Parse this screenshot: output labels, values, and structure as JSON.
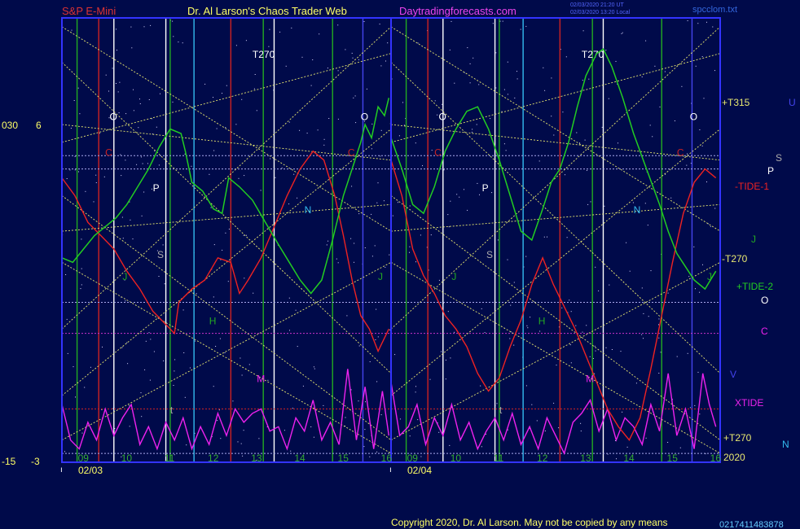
{
  "header": {
    "left_title": "S&P E-Mini",
    "center_title": "Dr. Al Larson's Chaos Trader Web",
    "site": "Daytradingforecasts.com",
    "stamp_line1": "02/03/2020 21:20 UT",
    "stamp_line2": "02/03/2020 13:20 Local",
    "file": "spcclom.txt"
  },
  "footer": {
    "copyright": "Copyright 2020, Dr. Al Larson. May not be copied by any means",
    "corner": "0217411483878"
  },
  "colors": {
    "background": "#000a4a",
    "frame": "#3333ff",
    "price": "#22cc22",
    "tide": "#ee2222",
    "xtide": "#ee22ee",
    "trend": "#e8e870",
    "marker_red": "#cc2222",
    "marker_green": "#22aa22",
    "marker_white": "#ffffff",
    "marker_cyan": "#33bbee",
    "marker_blue": "#4444ee"
  },
  "chart_data": {
    "type": "line",
    "y_scale_left": {
      "top_labels": [
        "030",
        "6"
      ],
      "bottom_labels": [
        "-15",
        "-3"
      ]
    },
    "panels": [
      {
        "date": "02/03",
        "hours": [
          "09",
          "10",
          "11",
          "12",
          "13",
          "14",
          "15",
          "16"
        ],
        "top_label": "T270",
        "glyphs": [
          {
            "text": "O",
            "color": "#ffffff",
            "t": 9.6,
            "v": 0.77
          },
          {
            "text": "C",
            "color": "#cc2222",
            "t": 9.5,
            "v": 0.69
          },
          {
            "text": "P",
            "color": "#ffffff",
            "t": 10.6,
            "v": 0.61
          },
          {
            "text": "S",
            "color": "#aaaaaa",
            "t": 10.7,
            "v": 0.46
          },
          {
            "text": "J",
            "color": "#22aa22",
            "t": 9.9,
            "v": 0.41
          },
          {
            "text": "H",
            "color": "#22aa22",
            "t": 11.9,
            "v": 0.31
          },
          {
            "text": "N",
            "color": "#33bbee",
            "t": 14.1,
            "v": 0.56
          },
          {
            "text": "M",
            "color": "#ee22ee",
            "t": 13.0,
            "v": 0.18
          },
          {
            "text": "t",
            "color": "#aaaaaa",
            "t": 11.0,
            "v": 0.11
          },
          {
            "text": "O",
            "color": "#ffffff",
            "t": 15.4,
            "v": 0.77
          },
          {
            "text": "C",
            "color": "#cc2222",
            "t": 15.1,
            "v": 0.69
          },
          {
            "text": "J",
            "color": "#22aa22",
            "t": 15.8,
            "v": 0.41
          }
        ],
        "price": [
          [
            8.5,
            0.46
          ],
          [
            8.75,
            0.45
          ],
          [
            9.0,
            0.48
          ],
          [
            9.25,
            0.51
          ],
          [
            9.5,
            0.53
          ],
          [
            9.75,
            0.55
          ],
          [
            10.0,
            0.58
          ],
          [
            10.25,
            0.62
          ],
          [
            10.5,
            0.66
          ],
          [
            10.75,
            0.71
          ],
          [
            11.0,
            0.75
          ],
          [
            11.25,
            0.74
          ],
          [
            11.35,
            0.7
          ],
          [
            11.5,
            0.63
          ],
          [
            11.75,
            0.61
          ],
          [
            12.0,
            0.57
          ],
          [
            12.2,
            0.56
          ],
          [
            12.35,
            0.64
          ],
          [
            12.6,
            0.62
          ],
          [
            12.9,
            0.59
          ],
          [
            13.2,
            0.54
          ],
          [
            13.5,
            0.49
          ],
          [
            13.75,
            0.45
          ],
          [
            14.0,
            0.41
          ],
          [
            14.25,
            0.38
          ],
          [
            14.5,
            0.41
          ],
          [
            14.75,
            0.5
          ],
          [
            15.0,
            0.6
          ],
          [
            15.2,
            0.66
          ],
          [
            15.4,
            0.72
          ],
          [
            15.5,
            0.76
          ],
          [
            15.65,
            0.73
          ],
          [
            15.8,
            0.8
          ],
          [
            15.95,
            0.78
          ],
          [
            16.05,
            0.82
          ]
        ],
        "tide": [
          [
            8.5,
            0.64
          ],
          [
            8.8,
            0.6
          ],
          [
            9.1,
            0.54
          ],
          [
            9.4,
            0.51
          ],
          [
            9.7,
            0.48
          ],
          [
            10.0,
            0.43
          ],
          [
            10.3,
            0.39
          ],
          [
            10.6,
            0.34
          ],
          [
            10.9,
            0.31
          ],
          [
            11.1,
            0.29
          ],
          [
            11.2,
            0.36
          ],
          [
            11.5,
            0.39
          ],
          [
            11.8,
            0.41
          ],
          [
            12.1,
            0.46
          ],
          [
            12.4,
            0.45
          ],
          [
            12.6,
            0.38
          ],
          [
            12.8,
            0.41
          ],
          [
            13.1,
            0.46
          ],
          [
            13.4,
            0.53
          ],
          [
            13.7,
            0.6
          ],
          [
            14.0,
            0.66
          ],
          [
            14.3,
            0.7
          ],
          [
            14.55,
            0.68
          ],
          [
            14.8,
            0.6
          ],
          [
            15.0,
            0.51
          ],
          [
            15.2,
            0.41
          ],
          [
            15.4,
            0.33
          ],
          [
            15.6,
            0.3
          ],
          [
            15.8,
            0.25
          ],
          [
            16.05,
            0.3
          ]
        ],
        "xtide": [
          [
            8.5,
            0.13
          ],
          [
            8.7,
            0.05
          ],
          [
            8.9,
            0.03
          ],
          [
            9.1,
            0.09
          ],
          [
            9.3,
            0.05
          ],
          [
            9.5,
            0.12
          ],
          [
            9.7,
            0.06
          ],
          [
            9.9,
            0.1
          ],
          [
            10.1,
            0.13
          ],
          [
            10.3,
            0.04
          ],
          [
            10.5,
            0.08
          ],
          [
            10.7,
            0.03
          ],
          [
            10.9,
            0.09
          ],
          [
            11.1,
            0.05
          ],
          [
            11.3,
            0.1
          ],
          [
            11.5,
            0.03
          ],
          [
            11.7,
            0.08
          ],
          [
            11.9,
            0.04
          ],
          [
            12.1,
            0.11
          ],
          [
            12.3,
            0.06
          ],
          [
            12.5,
            0.12
          ],
          [
            12.7,
            0.09
          ],
          [
            12.9,
            0.11
          ],
          [
            13.1,
            0.12
          ],
          [
            13.3,
            0.07
          ],
          [
            13.5,
            0.08
          ],
          [
            13.7,
            0.03
          ],
          [
            13.9,
            0.1
          ],
          [
            14.1,
            0.07
          ],
          [
            14.3,
            0.14
          ],
          [
            14.5,
            0.05
          ],
          [
            14.7,
            0.09
          ],
          [
            14.9,
            0.04
          ],
          [
            15.1,
            0.21
          ],
          [
            15.3,
            0.05
          ],
          [
            15.5,
            0.17
          ],
          [
            15.7,
            0.03
          ],
          [
            15.9,
            0.16
          ],
          [
            16.05,
            0.06
          ]
        ]
      },
      {
        "date": "02/04",
        "hours": [
          "09",
          "10",
          "11",
          "12",
          "13",
          "14",
          "15",
          "16"
        ],
        "top_label": "T270",
        "glyphs": [
          {
            "text": "O",
            "color": "#ffffff",
            "t": 9.6,
            "v": 0.77
          },
          {
            "text": "C",
            "color": "#cc2222",
            "t": 9.5,
            "v": 0.69
          },
          {
            "text": "P",
            "color": "#ffffff",
            "t": 10.6,
            "v": 0.61
          },
          {
            "text": "S",
            "color": "#aaaaaa",
            "t": 10.7,
            "v": 0.46
          },
          {
            "text": "J",
            "color": "#22aa22",
            "t": 9.9,
            "v": 0.41
          },
          {
            "text": "H",
            "color": "#22aa22",
            "t": 11.9,
            "v": 0.31
          },
          {
            "text": "N",
            "color": "#33bbee",
            "t": 14.1,
            "v": 0.56
          },
          {
            "text": "M",
            "color": "#ee22ee",
            "t": 13.0,
            "v": 0.18
          },
          {
            "text": "t",
            "color": "#aaaaaa",
            "t": 11.0,
            "v": 0.11
          },
          {
            "text": "O",
            "color": "#ffffff",
            "t": 15.4,
            "v": 0.77
          },
          {
            "text": "C",
            "color": "#cc2222",
            "t": 15.1,
            "v": 0.69
          },
          {
            "text": "J",
            "color": "#22aa22",
            "t": 15.8,
            "v": 0.41
          }
        ],
        "price": [
          [
            8.5,
            0.73
          ],
          [
            8.75,
            0.66
          ],
          [
            9.0,
            0.58
          ],
          [
            9.25,
            0.56
          ],
          [
            9.5,
            0.62
          ],
          [
            9.75,
            0.7
          ],
          [
            10.0,
            0.75
          ],
          [
            10.25,
            0.79
          ],
          [
            10.5,
            0.8
          ],
          [
            10.75,
            0.75
          ],
          [
            11.0,
            0.68
          ],
          [
            11.25,
            0.6
          ],
          [
            11.5,
            0.52
          ],
          [
            11.75,
            0.5
          ],
          [
            12.0,
            0.57
          ],
          [
            12.2,
            0.63
          ],
          [
            12.4,
            0.66
          ],
          [
            12.6,
            0.72
          ],
          [
            12.8,
            0.8
          ],
          [
            13.0,
            0.87
          ],
          [
            13.25,
            0.92
          ],
          [
            13.4,
            0.93
          ],
          [
            13.6,
            0.89
          ],
          [
            13.85,
            0.82
          ],
          [
            14.1,
            0.74
          ],
          [
            14.4,
            0.66
          ],
          [
            14.7,
            0.58
          ],
          [
            14.9,
            0.52
          ],
          [
            15.1,
            0.47
          ],
          [
            15.3,
            0.44
          ],
          [
            15.5,
            0.41
          ],
          [
            15.75,
            0.39
          ],
          [
            16.0,
            0.43
          ]
        ],
        "tide": [
          [
            8.5,
            0.68
          ],
          [
            8.75,
            0.6
          ],
          [
            9.0,
            0.48
          ],
          [
            9.25,
            0.42
          ],
          [
            9.5,
            0.38
          ],
          [
            9.75,
            0.33
          ],
          [
            10.0,
            0.3
          ],
          [
            10.25,
            0.26
          ],
          [
            10.5,
            0.2
          ],
          [
            10.75,
            0.16
          ],
          [
            11.0,
            0.19
          ],
          [
            11.25,
            0.26
          ],
          [
            11.5,
            0.32
          ],
          [
            11.75,
            0.4
          ],
          [
            12.0,
            0.46
          ],
          [
            12.25,
            0.4
          ],
          [
            12.5,
            0.35
          ],
          [
            12.75,
            0.3
          ],
          [
            13.0,
            0.24
          ],
          [
            13.25,
            0.18
          ],
          [
            13.5,
            0.12
          ],
          [
            13.75,
            0.08
          ],
          [
            14.0,
            0.05
          ],
          [
            14.25,
            0.1
          ],
          [
            14.5,
            0.21
          ],
          [
            14.75,
            0.33
          ],
          [
            15.0,
            0.45
          ],
          [
            15.25,
            0.56
          ],
          [
            15.5,
            0.63
          ],
          [
            15.75,
            0.66
          ],
          [
            16.0,
            0.64
          ]
        ],
        "xtide": [
          [
            8.5,
            0.18
          ],
          [
            8.7,
            0.06
          ],
          [
            8.9,
            0.08
          ],
          [
            9.1,
            0.13
          ],
          [
            9.3,
            0.04
          ],
          [
            9.5,
            0.1
          ],
          [
            9.7,
            0.06
          ],
          [
            9.9,
            0.13
          ],
          [
            10.1,
            0.05
          ],
          [
            10.3,
            0.09
          ],
          [
            10.5,
            0.03
          ],
          [
            10.7,
            0.07
          ],
          [
            10.9,
            0.1
          ],
          [
            11.1,
            0.05
          ],
          [
            11.3,
            0.11
          ],
          [
            11.5,
            0.04
          ],
          [
            11.7,
            0.08
          ],
          [
            11.9,
            0.03
          ],
          [
            12.1,
            0.1
          ],
          [
            12.3,
            0.06
          ],
          [
            12.5,
            0.02
          ],
          [
            12.7,
            0.09
          ],
          [
            12.9,
            0.11
          ],
          [
            13.1,
            0.14
          ],
          [
            13.3,
            0.07
          ],
          [
            13.5,
            0.12
          ],
          [
            13.7,
            0.05
          ],
          [
            13.9,
            0.1
          ],
          [
            14.1,
            0.08
          ],
          [
            14.3,
            0.04
          ],
          [
            14.5,
            0.13
          ],
          [
            14.7,
            0.07
          ],
          [
            14.9,
            0.2
          ],
          [
            15.1,
            0.06
          ],
          [
            15.3,
            0.12
          ],
          [
            15.5,
            0.03
          ],
          [
            15.7,
            0.2
          ],
          [
            15.85,
            0.13
          ],
          [
            16.0,
            0.08
          ]
        ]
      }
    ],
    "right_labels": [
      {
        "text": "+T315",
        "color": "#e8e870"
      },
      {
        "text": "U",
        "color": "#4444ee"
      },
      {
        "text": "S",
        "color": "#aaaaaa"
      },
      {
        "text": "P",
        "color": "#ffffff"
      },
      {
        "text": "-TIDE-1",
        "color": "#ee2222"
      },
      {
        "text": "J",
        "color": "#22aa22"
      },
      {
        "text": "-T270",
        "color": "#e8e870"
      },
      {
        "text": "+TIDE-2",
        "color": "#22cc22"
      },
      {
        "text": "O",
        "color": "#ffffff"
      },
      {
        "text": "C",
        "color": "#ee22ee"
      },
      {
        "text": "V",
        "color": "#4444ee"
      },
      {
        "text": "XTIDE",
        "color": "#ee22ee"
      },
      {
        "text": "+T270",
        "color": "#e8e870"
      },
      {
        "text": "N",
        "color": "#33bbee"
      },
      {
        "text": "2020",
        "color": "#e8e870"
      }
    ]
  }
}
